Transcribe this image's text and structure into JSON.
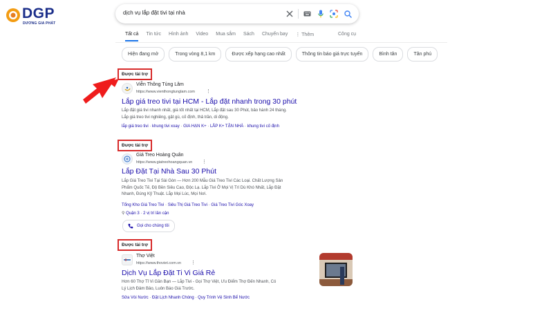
{
  "logo": {
    "brand": "DGP",
    "tagline": "DƯƠNG GIA PHÁT"
  },
  "search": {
    "query": "dịch vụ lắp đặt tivi tại nhà"
  },
  "tabs": {
    "items": [
      "Tất cả",
      "Tin tức",
      "Hình ảnh",
      "Video",
      "Mua sắm",
      "Sách",
      "Chuyến bay",
      "⋮ Thêm"
    ],
    "active": "Tất cả",
    "tools": "Công cụ"
  },
  "chips": [
    "Hiện đang mở",
    "Trong vòng 8,1 km",
    "Được xếp hạng cao nhất",
    "Thông tin báo giá trực tuyến",
    "Bình tân",
    "Tân phú"
  ],
  "results": [
    {
      "sponsored": "Được tài trợ",
      "site_name": "Viễn Thông Tùng Lâm",
      "url": "https://www.vienthongtunglam.com",
      "title": "Lắp giá treo tivi tại HCM - Lắp đặt nhanh trong 30 phút",
      "desc_1": "Lắp đặt giá tivi nhanh nhất, giá tốt nhất tại HCM, Lắp đặt sau 30 Phút, bảo hành 24 tháng.",
      "desc_2": "Lắp giá treo tivi nghiêng, gật gù, cố định, thả trần, di động.",
      "links": [
        "lắp giá treo tivi",
        "khung tivi xoay",
        "GIA HẠN K+",
        "LẮP K+ TẬN NHÀ",
        "khung tivi cố định"
      ]
    },
    {
      "sponsored": "Được tài trợ",
      "site_name": "Giá Treo Hoàng Quân",
      "url": "https://www.giatreohoangquan.vn",
      "title": "Lắp Đặt Tại Nhà Sau 30 Phút",
      "desc_1": "Lắp Giá Treo Tivi Tại Sài Gòn — Hơn 200 Mẫu Giá Treo Tivi Các Loại. Chất Lượng Sản",
      "desc_2": "Phẩm Quốc Tế, Độ Bền Siêu Cao, Độc Lạ. Lắp Tivi Ở Mọi Vị Trí Dù Khó Nhất, Lắp Đặt",
      "desc_3": "Nhanh, Đúng Kỹ Thuật. Lắp Mọi Lúc, Mọi Nơi.",
      "links": [
        "Tổng Kho Giá Treo Tivi",
        "Siêu Thị Giá Treo Tivi",
        "Giá Treo Tivi Góc Xoay"
      ],
      "location": "Quận 3 · 2 vị trí lân cận",
      "call": "Gọi cho chúng tôi"
    },
    {
      "sponsored": "Được tài trợ",
      "site_name": "Thợ Việt",
      "url": "https://www.thoviet.com.vn",
      "title": "Dịch Vụ Lắp Đặt Ti Vi Giá Rẻ",
      "desc_1": "Hơn 60 Thợ Tỉ Vi Gần Bạn — Lắp Tivi - Gọi Thợ Việt, Ưu Điểm Thợ Đến Nhanh, Có",
      "desc_2": "Lý Lịch Đảm Bảo, Luôn Báo Giá Trước.",
      "links": [
        "Sửa Vòi Nước",
        "Đặt Lịch Nhanh Chóng",
        "Quy Trình Vệ Sinh Bể Nước"
      ]
    }
  ],
  "colors": {
    "link": "#1a0dab",
    "highlight": "#d72a2a",
    "brand": "#1c2f8a"
  }
}
